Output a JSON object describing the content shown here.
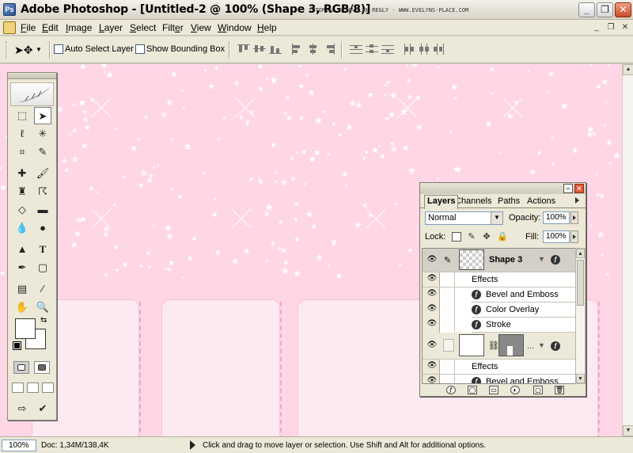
{
  "window": {
    "title": "Adobe Photoshop - [Untitled-2 @ 100% (Shape 3, RGB/8)]",
    "credit": "TUTORIAL BY EVELYN REGLY - WWW.EVELYNS-PLACE.COM",
    "icon": "photoshop-app-icon"
  },
  "menu": {
    "items": [
      {
        "pre": "",
        "u": "F",
        "post": "ile"
      },
      {
        "pre": "",
        "u": "E",
        "post": "dit"
      },
      {
        "pre": "",
        "u": "I",
        "post": "mage"
      },
      {
        "pre": "",
        "u": "L",
        "post": "ayer"
      },
      {
        "pre": "",
        "u": "S",
        "post": "elect"
      },
      {
        "pre": "Filt",
        "u": "e",
        "post": "r"
      },
      {
        "pre": "",
        "u": "V",
        "post": "iew"
      },
      {
        "pre": "",
        "u": "W",
        "post": "indow"
      },
      {
        "pre": "",
        "u": "H",
        "post": "elp"
      }
    ]
  },
  "options": {
    "auto_select": "Auto Select Layer",
    "bounding_box": "Show Bounding Box"
  },
  "layers_panel": {
    "tabs": [
      "Layers",
      "Channels",
      "Paths",
      "Actions"
    ],
    "blend_mode": "Normal",
    "opacity_label": "Opacity:",
    "opacity": "100%",
    "lock_label": "Lock:",
    "fill_label": "Fill:",
    "fill": "100%",
    "layers": [
      {
        "name": "Shape 3",
        "effects_label": "Effects",
        "effects": [
          "Bevel and Emboss",
          "Color Overlay",
          "Stroke"
        ]
      },
      {
        "name": "",
        "effects_label": "Effects",
        "effects": [
          "Bevel and Emboss"
        ]
      }
    ]
  },
  "status": {
    "zoom": "100%",
    "doc": "Doc: 1,34M/138,4K",
    "message": "Click and drag to move layer or selection.  Use Shift and Alt for additional options."
  },
  "colors": {
    "canvas": "#ffd6e6",
    "card": "#fde9f2",
    "chrome": "#ece9d8",
    "layer_selected": "#d4d0c8"
  }
}
